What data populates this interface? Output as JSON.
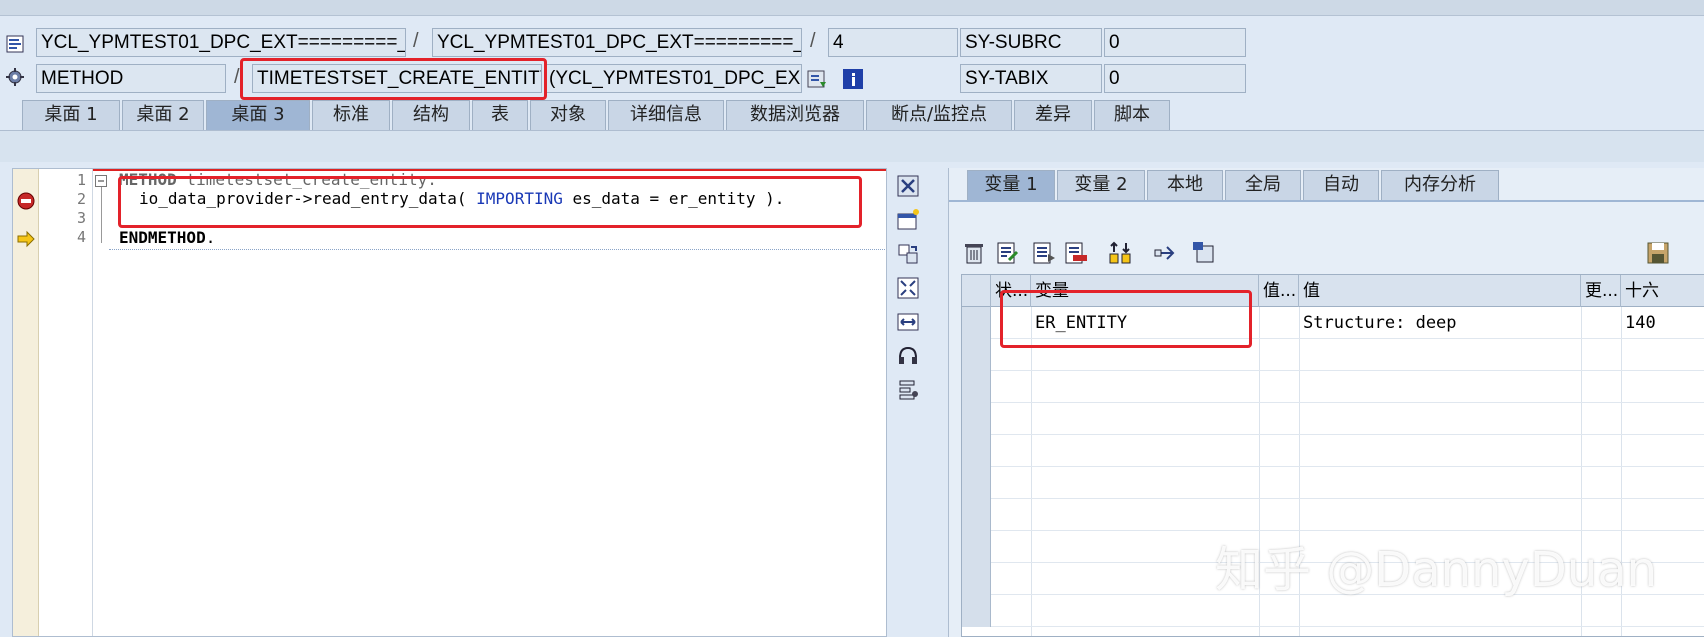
{
  "header": {
    "row1": {
      "program": "YCL_YPMTEST01_DPC_EXT=========_",
      "include": "YCL_YPMTEST01_DPC_EXT=========_",
      "line": "4",
      "sy1_label": "SY-SUBRC",
      "sy1_value": "0"
    },
    "row2": {
      "event_type": "METHOD",
      "event_name": "TIMETESTSET_CREATE_ENTITY",
      "event_class": "(YCL_YPMTEST01_DPC_EX…",
      "sy2_label": "SY-TABIX",
      "sy2_value": "0"
    },
    "separator": "/"
  },
  "desktop_tabs": [
    "桌面 1",
    "桌面 2",
    "桌面 3",
    "标准",
    "结构",
    "表",
    "对象",
    "详细信息",
    "数据浏览器",
    "断点/监控点",
    "差异",
    "脚本"
  ],
  "active_desktop_tab": "桌面 3",
  "editor": {
    "line_numbers": [
      "1",
      "2",
      "3",
      "4"
    ],
    "line1_kw": "METHOD",
    "line1_rest": " timetestset_create_entity.",
    "line2_a": "io_data_provider->read_entry_data( ",
    "line2_kw": "IMPORTING",
    "line2_b": " es_data = er_entity ).",
    "line4_kw": "ENDMETHOD",
    "line4_rest": "."
  },
  "var_tabs": [
    "变量 1",
    "变量 2",
    "本地",
    "全局",
    "自动",
    "内存分析"
  ],
  "active_var_tab": "变量 1",
  "var_table": {
    "columns": [
      "状...",
      "变量",
      "值...",
      "值",
      "更...",
      "十六"
    ],
    "rows": [
      {
        "variable": "ER_ENTITY",
        "value": "Structure: deep",
        "hex": "140"
      }
    ]
  },
  "watermark": "知乎 @DannyDuan",
  "colors": {
    "highlight_box": "#e3222a",
    "keyword": "#1a39b6",
    "active_tab": "#9fb6d4"
  }
}
